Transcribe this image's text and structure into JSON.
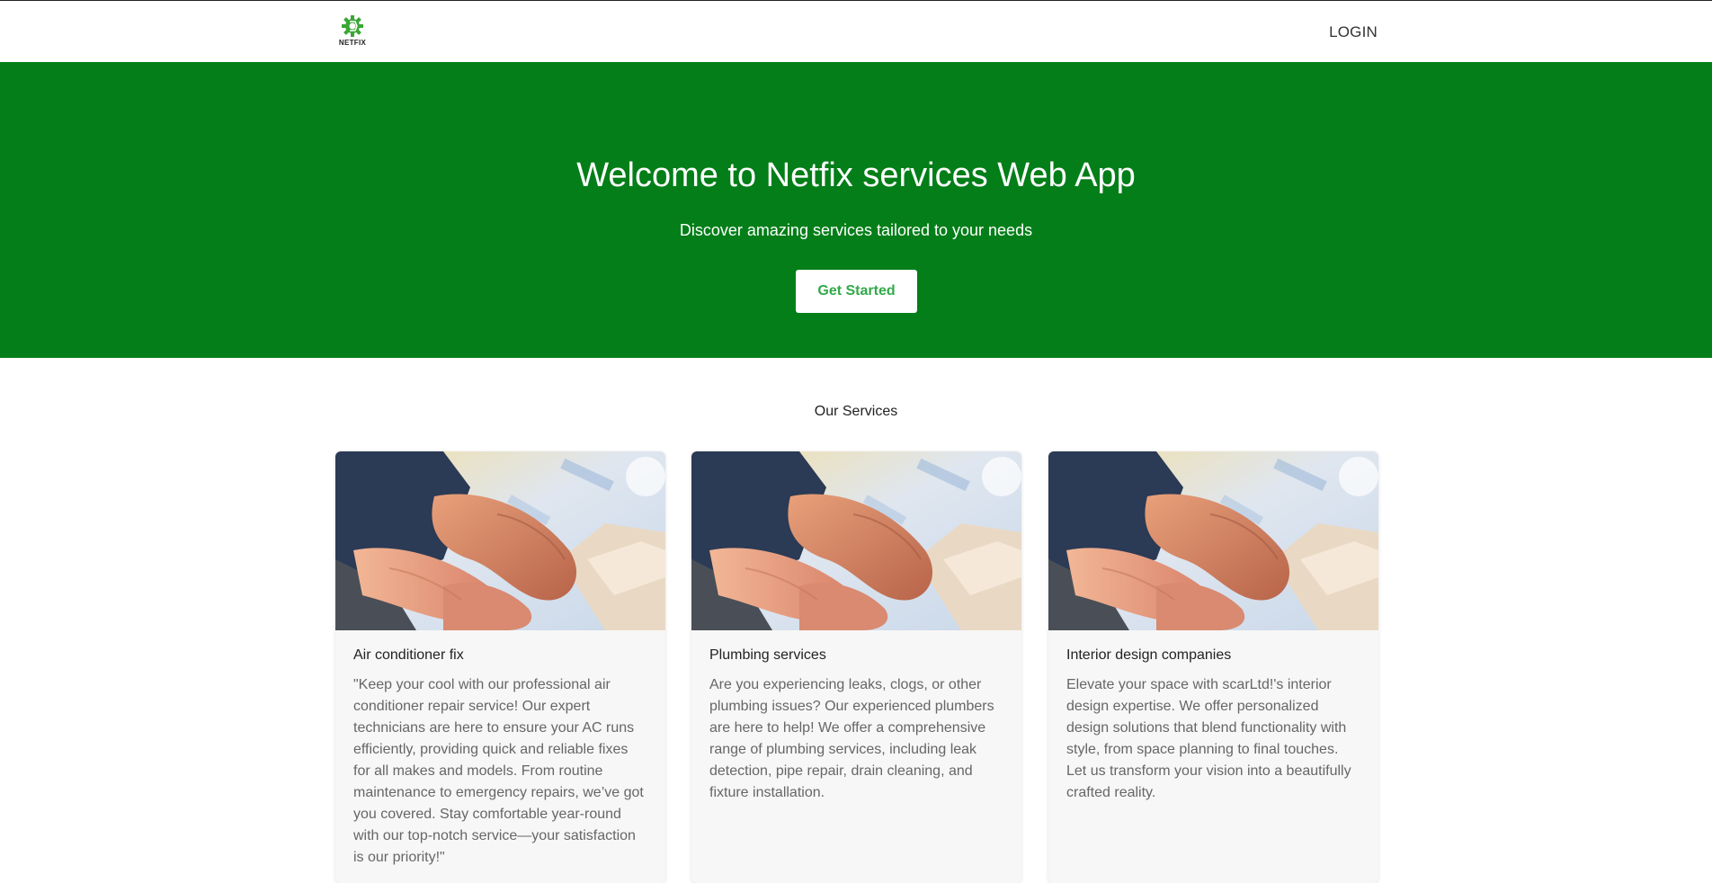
{
  "navbar": {
    "logo_text": "NETFIX",
    "login_label": "LOGIN"
  },
  "hero": {
    "title": "Welcome to Netfix services Web App",
    "subtitle": "Discover amazing services tailored to your needs",
    "cta_label": "Get Started",
    "background_color": "#037e18"
  },
  "services": {
    "title": "Our Services",
    "items": [
      {
        "title": "Air conditioner fix",
        "description": "\"Keep your cool with our professional air conditioner repair service! Our expert technicians are here to ensure your AC runs efficiently, providing quick and reliable fixes for all makes and models. From routine maintenance to emergency repairs, we’ve got you covered. Stay comfortable year-round with our top-notch service—your satisfaction is our priority!\""
      },
      {
        "title": "Plumbing services",
        "description": "Are you experiencing leaks, clogs, or other plumbing issues? Our experienced plumbers are here to help! We offer a comprehensive range of plumbing services, including leak detection, pipe repair, drain cleaning, and fixture installation."
      },
      {
        "title": "Interior design companies",
        "description": "Elevate your space with scarLtd!'s interior design expertise. We offer personalized design solutions that blend functionality with style, from space planning to final touches. Let us transform your vision into a beautifully crafted reality."
      }
    ]
  }
}
